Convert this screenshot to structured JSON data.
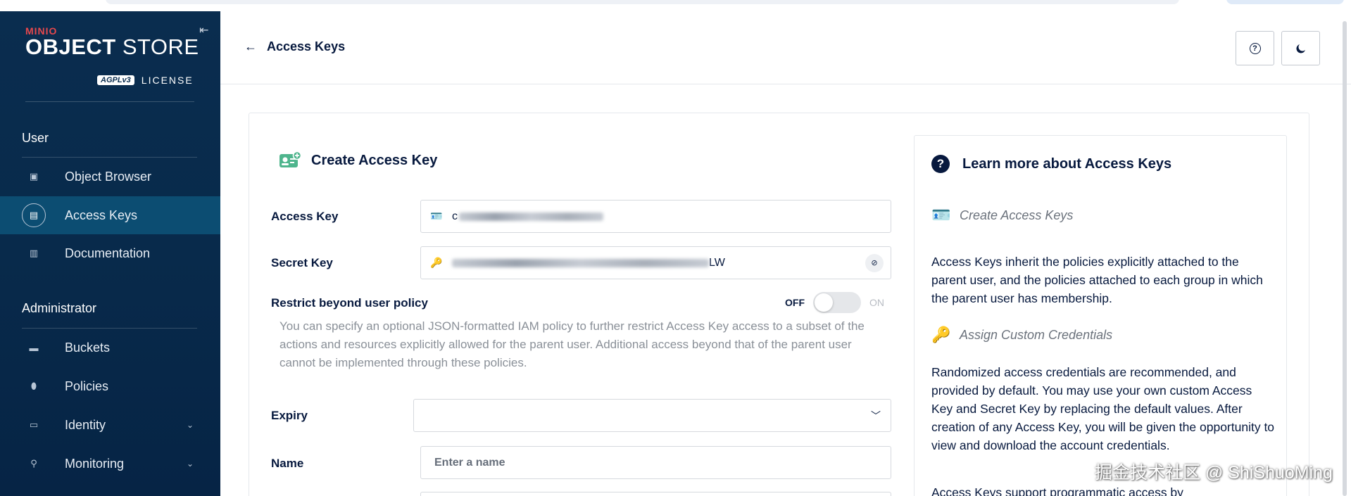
{
  "brand": {
    "minio": "MINIO",
    "object": "OBJECT",
    "store": " STORE",
    "agpl": "AGPLv3",
    "license": "LICENSE"
  },
  "sidebar": {
    "user_section": "User",
    "admin_section": "Administrator",
    "user_items": [
      {
        "label": "Object Browser",
        "icon": "object-browser-icon"
      },
      {
        "label": "Access Keys",
        "icon": "access-keys-icon"
      },
      {
        "label": "Documentation",
        "icon": "documentation-icon"
      }
    ],
    "admin_items": [
      {
        "label": "Buckets",
        "icon": "buckets-icon"
      },
      {
        "label": "Policies",
        "icon": "policies-icon"
      },
      {
        "label": "Identity",
        "icon": "identity-icon"
      },
      {
        "label": "Monitoring",
        "icon": "monitoring-icon"
      }
    ]
  },
  "header": {
    "back_label": "Access Keys"
  },
  "form": {
    "title": "Create Access Key",
    "access_key_label": "Access Key",
    "access_key_prefix": "c",
    "secret_key_label": "Secret Key",
    "secret_key_suffix": "LW",
    "restrict_label": "Restrict beyond user policy",
    "toggle_off": "OFF",
    "toggle_on": "ON",
    "restrict_description": "You can specify an optional JSON-formatted IAM policy to further restrict Access Key access to a subset of the actions and resources explicitly allowed for the parent user. Additional access beyond that of the parent user cannot be implemented through these policies.",
    "expiry_label": "Expiry",
    "name_label": "Name",
    "name_placeholder": "Enter a name"
  },
  "help": {
    "title": "Learn more about Access Keys",
    "sub1": "Create Access Keys",
    "para1": "Access Keys inherit the policies explicitly attached to the parent user, and the policies attached to each group in which the parent user has membership.",
    "sub2": "Assign Custom Credentials",
    "para2": "Randomized access credentials are recommended, and provided by default. You may use your own custom Access Key and Secret Key by replacing the default values. After creation of any Access Key, you will be given the opportunity to view and download the account credentials.",
    "para3": "Access Keys support programmatic access by"
  },
  "watermark": "掘金技术社区 @ ShiShuoMing",
  "colors": {
    "sidebar_bg": "#0a2d4f",
    "active_item": "#0c4d72",
    "text_dark": "#07193e",
    "brand_red": "#e5484d"
  }
}
